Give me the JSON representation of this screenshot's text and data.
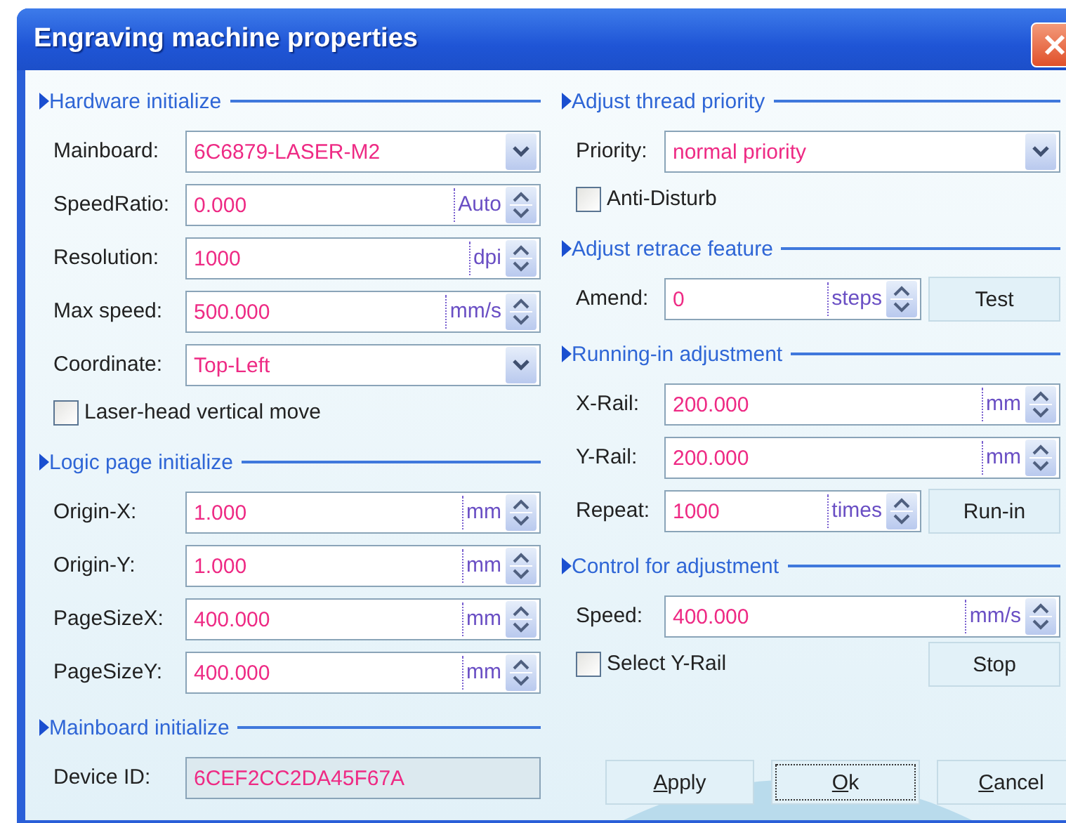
{
  "window": {
    "title": "Engraving machine properties"
  },
  "columns": [
    {
      "sections": [
        {
          "title": "Hardware initialize",
          "rows": [
            {
              "kind": "combo",
              "label": "Mainboard:",
              "value": "6C6879-LASER-M2"
            },
            {
              "kind": "spin",
              "label": "SpeedRatio:",
              "value": "0.000",
              "unit": "Auto"
            },
            {
              "kind": "spin",
              "label": "Resolution:",
              "value": "1000",
              "unit": "dpi"
            },
            {
              "kind": "spin",
              "label": "Max speed:",
              "value": "500.000",
              "unit": "mm/s"
            },
            {
              "kind": "combo",
              "label": "Coordinate:",
              "value": "Top-Left"
            },
            {
              "kind": "checkbox",
              "label": "Laser-head vertical move",
              "checked": false
            }
          ]
        },
        {
          "title": "Logic page initialize",
          "rows": [
            {
              "kind": "spin",
              "label": "Origin-X:",
              "value": "1.000",
              "unit": "mm"
            },
            {
              "kind": "spin",
              "label": "Origin-Y:",
              "value": "1.000",
              "unit": "mm"
            },
            {
              "kind": "spin",
              "label": "PageSizeX:",
              "value": "400.000",
              "unit": "mm"
            },
            {
              "kind": "spin",
              "label": "PageSizeY:",
              "value": "400.000",
              "unit": "mm"
            }
          ]
        },
        {
          "title": "Mainboard initialize",
          "rows": [
            {
              "kind": "readonly",
              "label": "Device ID:",
              "value": "6CEF2CC2DA45F67A"
            }
          ]
        }
      ]
    },
    {
      "sections": [
        {
          "title": "Adjust thread priority",
          "rows": [
            {
              "kind": "combo",
              "label": "Priority:",
              "value": "normal priority"
            },
            {
              "kind": "checkbox",
              "label": "Anti-Disturb",
              "checked": false
            }
          ]
        },
        {
          "title": "Adjust retrace feature",
          "rows": [
            {
              "kind": "spin",
              "label": "Amend:",
              "value": "0",
              "unit": "steps",
              "button": "Test"
            }
          ]
        },
        {
          "title": "Running-in adjustment",
          "rows": [
            {
              "kind": "spin",
              "label": "X-Rail:",
              "value": "200.000",
              "unit": "mm"
            },
            {
              "kind": "spin",
              "label": "Y-Rail:",
              "value": "200.000",
              "unit": "mm"
            },
            {
              "kind": "spin",
              "label": "Repeat:",
              "value": "1000",
              "unit": "times",
              "button": "Run-in"
            }
          ]
        },
        {
          "title": "Control for adjustment",
          "rows": [
            {
              "kind": "spin",
              "label": "Speed:",
              "value": "400.000",
              "unit": "mm/s"
            },
            {
              "kind": "checkbox",
              "label": "Select Y-Rail",
              "checked": false,
              "button": "Stop"
            }
          ]
        }
      ]
    }
  ],
  "buttons": [
    {
      "label": "Apply",
      "first_letter_underlined": true,
      "focused": false
    },
    {
      "label": "Ok",
      "first_letter_underlined": true,
      "focused": true
    },
    {
      "label": "Cancel",
      "first_letter_underlined": true,
      "focused": false
    }
  ]
}
